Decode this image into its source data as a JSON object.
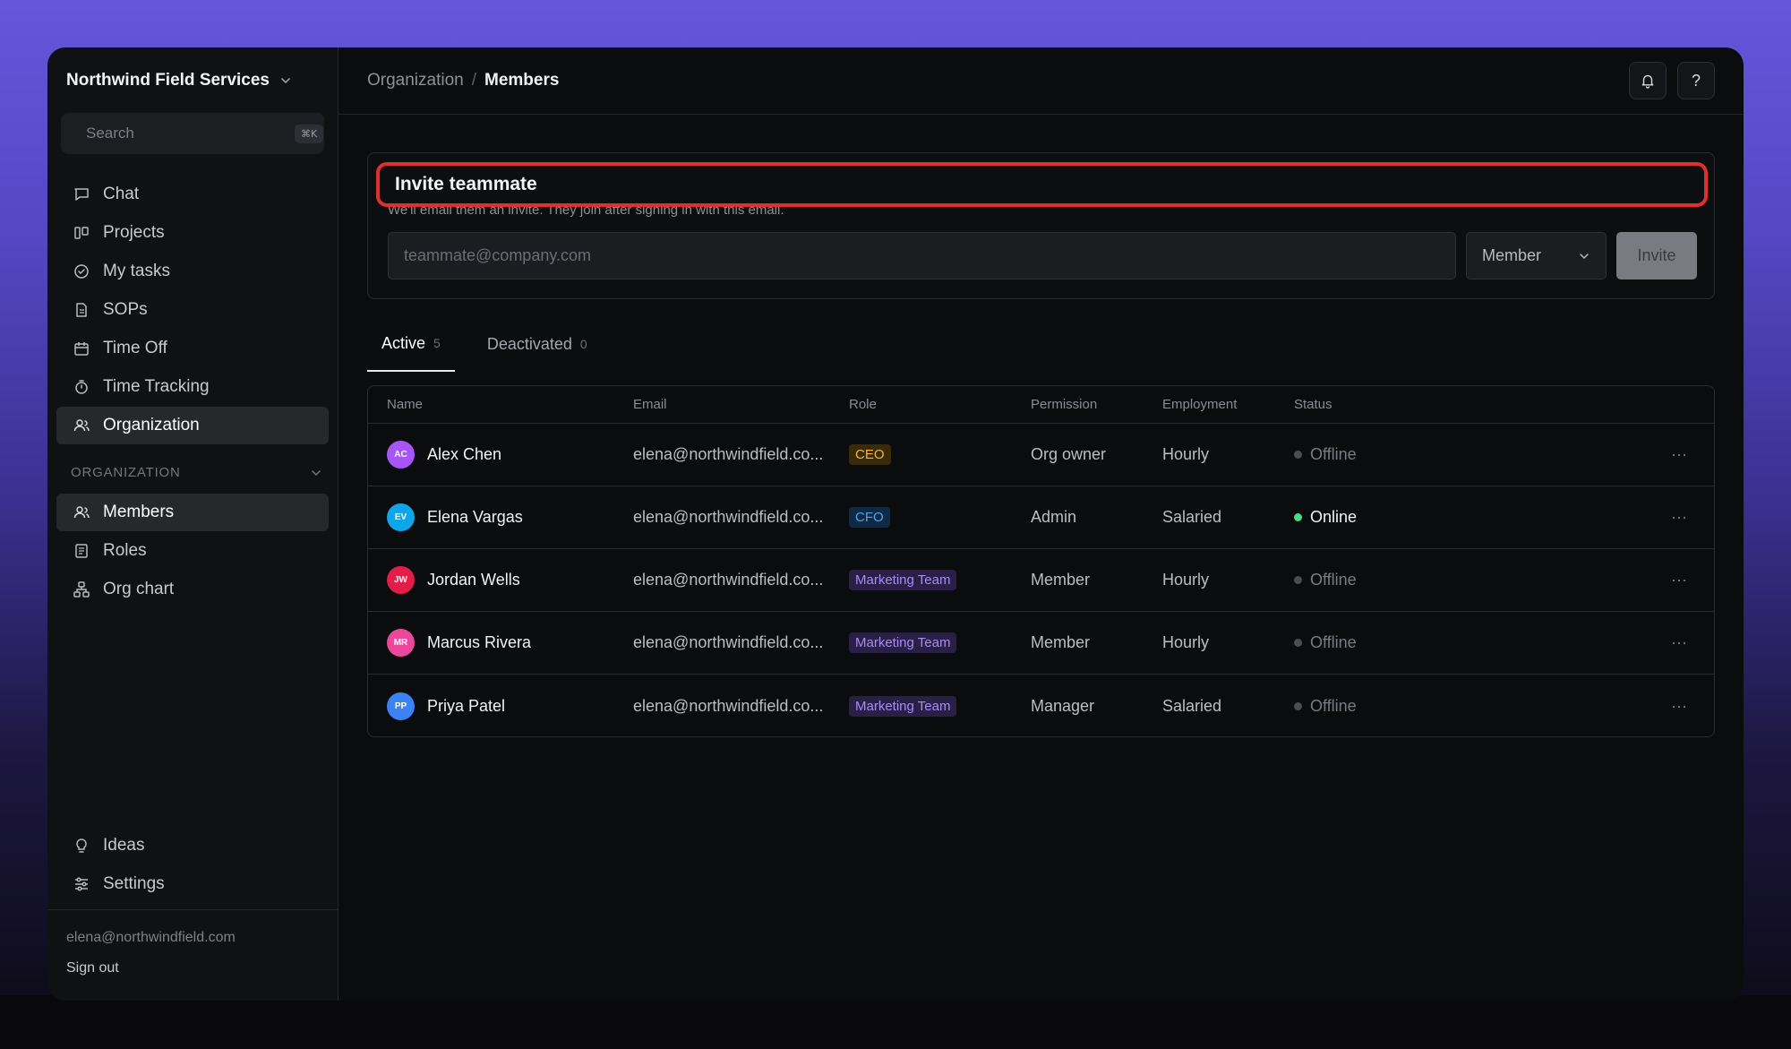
{
  "sidebar": {
    "org_name": "Northwind Field Services",
    "search_placeholder": "Search",
    "search_shortcut": "⌘K",
    "nav": [
      {
        "label": "Chat",
        "icon": "chat-icon"
      },
      {
        "label": "Projects",
        "icon": "projects-icon"
      },
      {
        "label": "My tasks",
        "icon": "tasks-icon"
      },
      {
        "label": "SOPs",
        "icon": "document-icon"
      },
      {
        "label": "Time Off",
        "icon": "calendar-icon"
      },
      {
        "label": "Time Tracking",
        "icon": "stopwatch-icon"
      },
      {
        "label": "Organization",
        "icon": "users-icon"
      }
    ],
    "section_label": "ORGANIZATION",
    "sub_nav": [
      {
        "label": "Members",
        "icon": "users-icon"
      },
      {
        "label": "Roles",
        "icon": "roles-icon"
      },
      {
        "label": "Org chart",
        "icon": "org-chart-icon"
      }
    ],
    "bottom_nav": [
      {
        "label": "Ideas",
        "icon": "lightbulb-icon"
      },
      {
        "label": "Settings",
        "icon": "sliders-icon"
      }
    ],
    "user_email": "elena@northwindfield.com",
    "sign_out": "Sign out"
  },
  "header": {
    "breadcrumb_parent": "Organization",
    "breadcrumb_sep": "/",
    "breadcrumb_current": "Members",
    "help_label": "?"
  },
  "invite": {
    "title": "Invite teammate",
    "subtitle": "We'll email them an invite. They join after signing in with this email.",
    "email_placeholder": "teammate@company.com",
    "email_value": "",
    "role_value": "Member",
    "button_label": "Invite"
  },
  "tabs": [
    {
      "label": "Active",
      "count": "5"
    },
    {
      "label": "Deactivated",
      "count": "0"
    }
  ],
  "table": {
    "columns": [
      "Name",
      "Email",
      "Role",
      "Permission",
      "Employment",
      "Status"
    ],
    "rows": [
      {
        "initials": "AC",
        "name": "Alex Chen",
        "email": "elena@northwindfield.co...",
        "role": "CEO",
        "permission": "Org owner",
        "employment": "Hourly",
        "status": "Offline",
        "menu": "···"
      },
      {
        "initials": "EV",
        "name": "Elena Vargas",
        "email": "elena@northwindfield.co...",
        "role": "CFO",
        "permission": "Admin",
        "employment": "Salaried",
        "status": "Online",
        "menu": "···"
      },
      {
        "initials": "JW",
        "name": "Jordan Wells",
        "email": "elena@northwindfield.co...",
        "role": "Marketing Team",
        "permission": "Member",
        "employment": "Hourly",
        "status": "Offline",
        "menu": "···"
      },
      {
        "initials": "MR",
        "name": "Marcus Rivera",
        "email": "elena@northwindfield.co...",
        "role": "Marketing Team",
        "permission": "Member",
        "employment": "Hourly",
        "status": "Offline",
        "menu": "···"
      },
      {
        "initials": "PP",
        "name": "Priya Patel",
        "email": "elena@northwindfield.co...",
        "role": "Marketing Team",
        "permission": "Manager",
        "employment": "Salaried",
        "status": "Offline",
        "menu": "···"
      }
    ]
  },
  "colors": {
    "avatar_ac": "#a855f7",
    "avatar_ev": "#0ea5e9",
    "avatar_jw": "#e11d48",
    "avatar_mr": "#ec4899",
    "avatar_pp": "#3b82f6",
    "badge_ceo_bg": "#3a2a0c",
    "badge_ceo_fg": "#f5b53b",
    "badge_cfo_bg": "#102a44",
    "badge_cfo_fg": "#4fa3f0",
    "badge_team_bg": "#2a1f45",
    "badge_team_fg": "#a78bfa",
    "online": "#4ade80",
    "offline": "#4b4d53",
    "highlight": "#e0302e"
  }
}
